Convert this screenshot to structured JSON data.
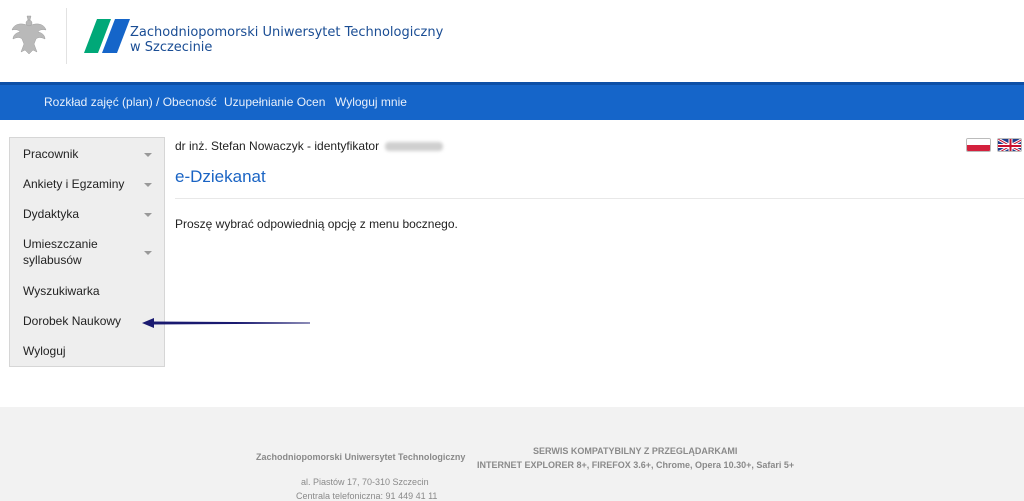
{
  "header": {
    "university_name_line1": "Zachodniopomorski Uniwersytet Technologiczny",
    "university_name_line2": "w Szczecinie",
    "brand_color": "#1565c9",
    "logo_colors": [
      "#00a878",
      "#1565c9"
    ]
  },
  "navbar": {
    "items": [
      {
        "label": "Rozkład zajęć (plan) / Obecność"
      },
      {
        "label": "Uzupełnianie Ocen"
      },
      {
        "label": "Wyloguj mnie"
      }
    ]
  },
  "sidebar": {
    "items": [
      {
        "label": "Pracownik",
        "has_submenu": true
      },
      {
        "label": "Ankiety i Egzaminy",
        "has_submenu": true
      },
      {
        "label": "Dydaktyka",
        "has_submenu": true
      },
      {
        "label_line1": "Umieszczanie",
        "label_line2": "syllabusów",
        "has_submenu": true
      },
      {
        "label": "Wyszukiwarka",
        "has_submenu": false
      },
      {
        "label": "Dorobek Naukowy",
        "has_submenu": false
      },
      {
        "label": "Wyloguj",
        "has_submenu": false
      }
    ]
  },
  "main": {
    "user_line": "dr inż. Stefan Nowaczyk - identyfikator",
    "page_title": "e-Dziekanat",
    "message": "Proszę wybrać odpowiednią opcję z menu bocznego."
  },
  "footer": {
    "org_name": "Zachodniopomorski Uniwersytet Technologiczny",
    "address": "al. Piastów 17, 70-310 Szczecin",
    "phone": "Centrala telefoniczna: 91 449 41 11",
    "compat_line1": "SERWIS KOMPATYBILNY Z PRZEGLĄDARKAMI",
    "compat_line2": "INTERNET EXPLORER 8+, FIREFOX 3.6+, Chrome, Opera 10.30+, Safari 5+"
  }
}
